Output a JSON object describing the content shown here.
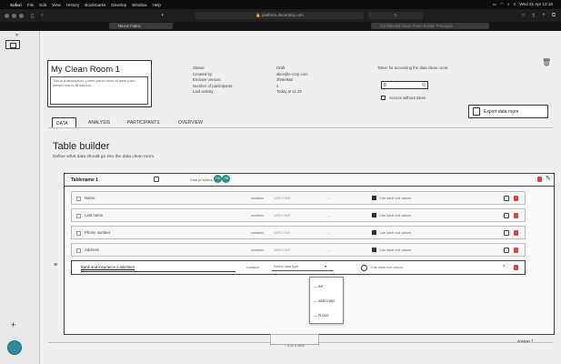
{
  "menubar": {
    "apple": "",
    "items": [
      "Safari",
      "File",
      "Edit",
      "View",
      "History",
      "Bookmarks",
      "Develop",
      "Window",
      "Help"
    ],
    "clock": "Wed 21 Apr 13:16"
  },
  "browser": {
    "address": "🔒 platform.decentriq.com",
    "address_secondary": "",
    "tabs": [
      "Nexus Fabric",
      "Confidential Clean Room Builder Prototype"
    ]
  },
  "room": {
    "name": "My Clean Room 1",
    "description": "This is a description. Lorem ipsum dolor sit amet justo sample text to fill this box.",
    "status_labels": [
      "Status:",
      "Created by:",
      "Enclave version:",
      "Number of participants:",
      "Last activity:"
    ],
    "status_values": [
      "Draft",
      "alice@e-corp.com",
      "3fe8e9a6",
      "2",
      "Today at 11:22"
    ],
    "token_label": "Token for accessing the data clean room:",
    "token_value": "8",
    "access_without_token": "Access without token",
    "export_label": "Export data room"
  },
  "tabs": [
    "DATA",
    "ANALYSIS",
    "PARTICIPANTS",
    "OVERVIEW"
  ],
  "builder": {
    "title": "Table builder",
    "subtitle": "Define what data should go into the data clean room.",
    "table_name": "Tablename 1",
    "data_providers_label": "Data providers",
    "providers": [
      "GA",
      "GB"
    ],
    "add_table": "+ Add a table",
    "analysis": "Analysis"
  },
  "rows": [
    {
      "name": "Name",
      "type_label": "contains",
      "type": "VARCHAR",
      "nullable": "Can have null values"
    },
    {
      "name": "Last name",
      "type_label": "contains",
      "type": "VARCHAR",
      "nullable": "Can have null values"
    },
    {
      "name": "Phone number",
      "type_label": "contains",
      "type": "VARCHAR",
      "nullable": "Can have null values"
    },
    {
      "name": "Address",
      "type_label": "contains",
      "type": "VARCHAR",
      "nullable": "Can have null values"
    }
  ],
  "new_row": {
    "name": "Bank and insurance customers",
    "type_label": "contains",
    "type_placeholder": "Select data type",
    "nullable": "Can have null values"
  },
  "dropdown": [
    "INT",
    "VARCHAR",
    "FLOAT"
  ]
}
